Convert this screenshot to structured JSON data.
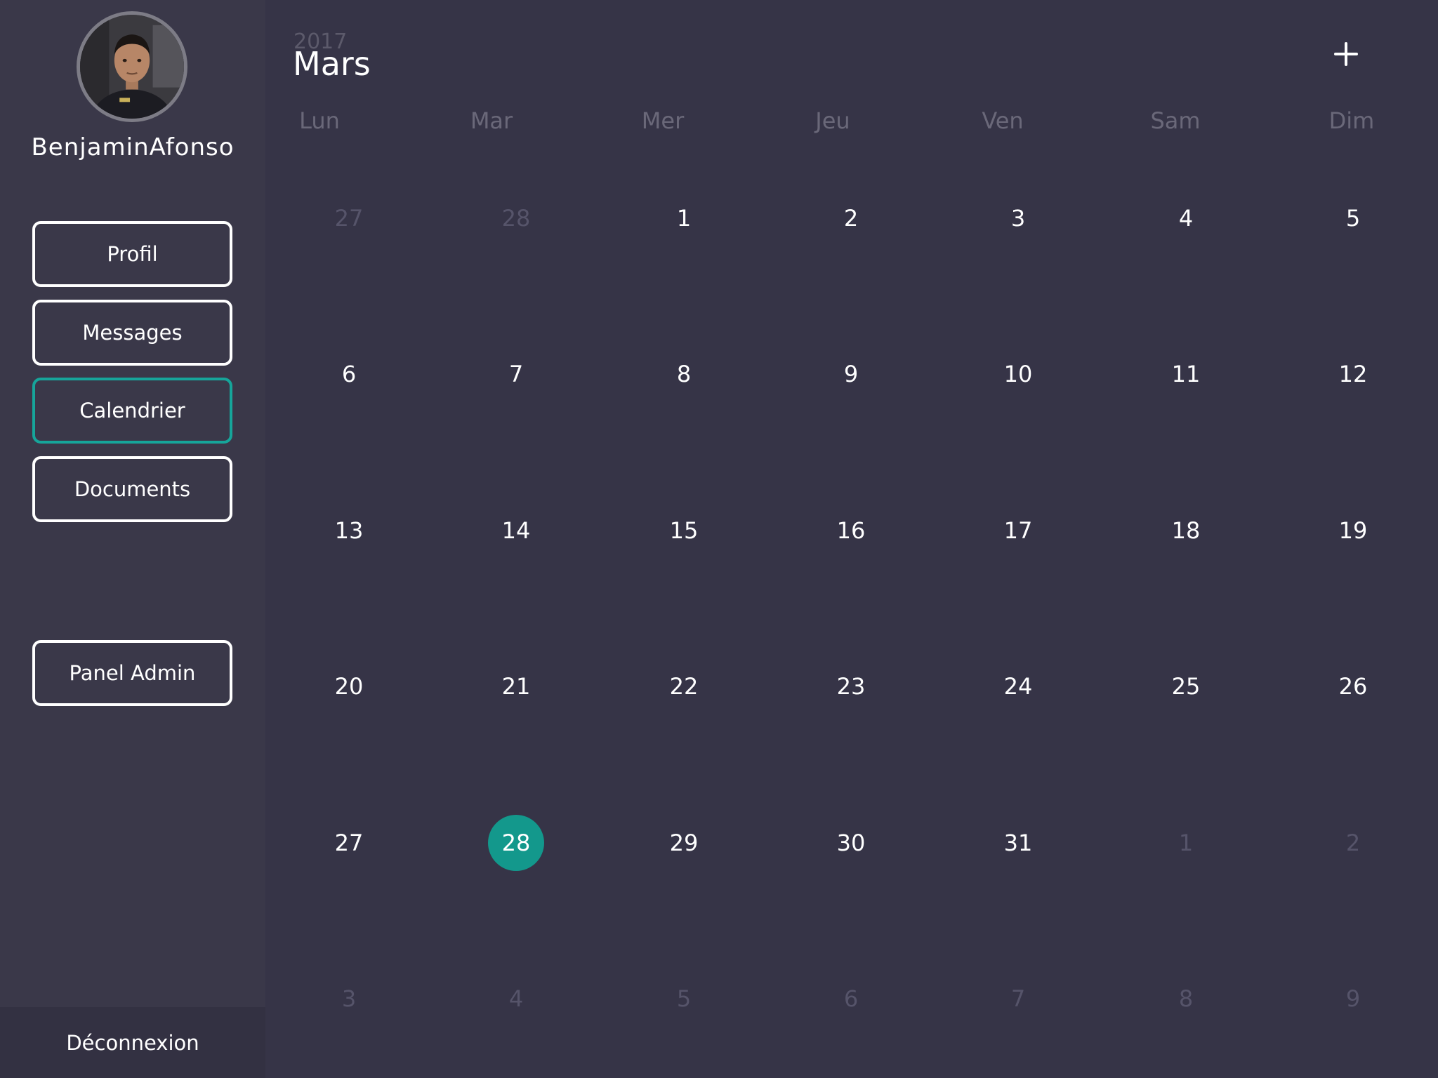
{
  "user": {
    "name": "BenjaminAfonso"
  },
  "nav": {
    "items": [
      {
        "label": "Profil",
        "active": false
      },
      {
        "label": "Messages",
        "active": false
      },
      {
        "label": "Calendrier",
        "active": true
      },
      {
        "label": "Documents",
        "active": false
      }
    ],
    "admin_label": "Panel Admin",
    "logout_label": "Déconnexion"
  },
  "calendar": {
    "year": "2017",
    "month": "Mars",
    "add_icon": "plus-icon",
    "weekdays": [
      "Lun",
      "Mar",
      "Mer",
      "Jeu",
      "Ven",
      "Sam",
      "Dim"
    ],
    "weeks": [
      [
        {
          "d": "27",
          "muted": true
        },
        {
          "d": "28",
          "muted": true
        },
        {
          "d": "1"
        },
        {
          "d": "2"
        },
        {
          "d": "3"
        },
        {
          "d": "4"
        },
        {
          "d": "5"
        }
      ],
      [
        {
          "d": "6"
        },
        {
          "d": "7"
        },
        {
          "d": "8"
        },
        {
          "d": "9"
        },
        {
          "d": "10"
        },
        {
          "d": "11"
        },
        {
          "d": "12"
        }
      ],
      [
        {
          "d": "13"
        },
        {
          "d": "14"
        },
        {
          "d": "15"
        },
        {
          "d": "16"
        },
        {
          "d": "17"
        },
        {
          "d": "18"
        },
        {
          "d": "19"
        }
      ],
      [
        {
          "d": "20"
        },
        {
          "d": "21"
        },
        {
          "d": "22"
        },
        {
          "d": "23"
        },
        {
          "d": "24"
        },
        {
          "d": "25"
        },
        {
          "d": "26"
        }
      ],
      [
        {
          "d": "27"
        },
        {
          "d": "28",
          "today": true
        },
        {
          "d": "29"
        },
        {
          "d": "30"
        },
        {
          "d": "31"
        },
        {
          "d": "1",
          "muted": true
        },
        {
          "d": "2",
          "muted": true
        }
      ],
      [
        {
          "d": "3",
          "muted": true
        },
        {
          "d": "4",
          "muted": true
        },
        {
          "d": "5",
          "muted": true
        },
        {
          "d": "6",
          "muted": true
        },
        {
          "d": "7",
          "muted": true
        },
        {
          "d": "8",
          "muted": true
        },
        {
          "d": "9",
          "muted": true
        }
      ]
    ]
  },
  "colors": {
    "background": "#363447",
    "sidebar": "#3a3849",
    "accent": "#13988c",
    "muted_text": "#56546a"
  }
}
